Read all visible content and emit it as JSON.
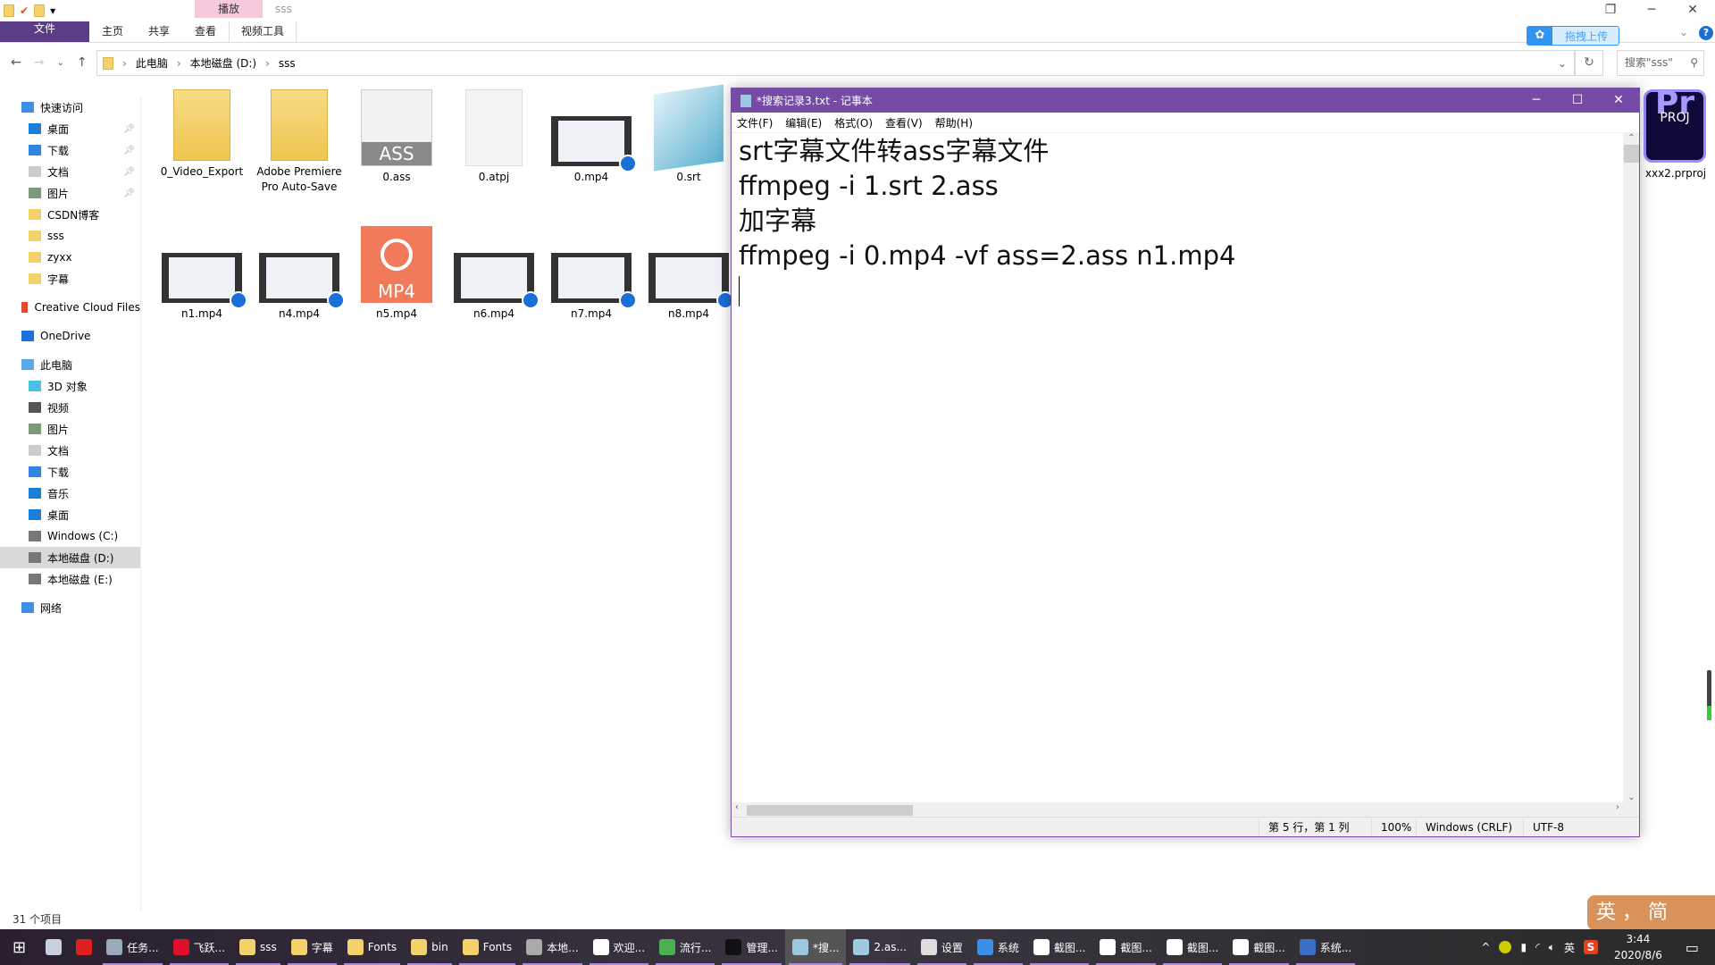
{
  "explorer": {
    "window_title": "sss",
    "context_tab_group": "播放",
    "ribbon_tabs": [
      "文件",
      "主页",
      "共享",
      "查看",
      "视频工具"
    ],
    "upload_label": "拖拽上传",
    "breadcrumb": [
      "此电脑",
      "本地磁盘 (D:)",
      "sss"
    ],
    "search_placeholder": "搜索\"sss\"",
    "sidebar": [
      {
        "label": "快速访问",
        "icon": "star-icon",
        "level": 0
      },
      {
        "label": "桌面",
        "icon": "desktop-icon",
        "level": 1,
        "pinned": true
      },
      {
        "label": "下载",
        "icon": "download-icon",
        "level": 1,
        "pinned": true
      },
      {
        "label": "文档",
        "icon": "document-icon",
        "level": 1,
        "pinned": true
      },
      {
        "label": "图片",
        "icon": "picture-icon",
        "level": 1,
        "pinned": true
      },
      {
        "label": "CSDN博客",
        "icon": "folder-icon",
        "level": 1
      },
      {
        "label": "sss",
        "icon": "folder-icon",
        "level": 1
      },
      {
        "label": "zyxx",
        "icon": "folder-icon",
        "level": 1
      },
      {
        "label": "字幕",
        "icon": "folder-icon",
        "level": 1
      },
      {
        "label": "Creative Cloud Files",
        "icon": "creative-cloud-icon",
        "level": 0
      },
      {
        "label": "OneDrive",
        "icon": "cloud-icon",
        "level": 0
      },
      {
        "label": "此电脑",
        "icon": "computer-icon",
        "level": 0
      },
      {
        "label": "3D 对象",
        "icon": "cube-icon",
        "level": 1
      },
      {
        "label": "视频",
        "icon": "video-icon",
        "level": 1
      },
      {
        "label": "图片",
        "icon": "picture-icon",
        "level": 1
      },
      {
        "label": "文档",
        "icon": "document-icon",
        "level": 1
      },
      {
        "label": "下载",
        "icon": "download-icon",
        "level": 1
      },
      {
        "label": "音乐",
        "icon": "music-icon",
        "level": 1
      },
      {
        "label": "桌面",
        "icon": "desktop-icon",
        "level": 1
      },
      {
        "label": "Windows (C:)",
        "icon": "drive-icon",
        "level": 1
      },
      {
        "label": "本地磁盘 (D:)",
        "icon": "drive-icon",
        "level": 1,
        "selected": true
      },
      {
        "label": "本地磁盘 (E:)",
        "icon": "drive-icon",
        "level": 1
      },
      {
        "label": "网络",
        "icon": "network-icon",
        "level": 0
      }
    ],
    "files_row1": [
      {
        "name": "0_Video_Export",
        "type": "folder"
      },
      {
        "name": "Adobe Premiere Pro Auto-Save",
        "type": "folder"
      },
      {
        "name": "0.ass",
        "type": "ass"
      },
      {
        "name": "0.atpj",
        "type": "blank"
      },
      {
        "name": "0.mp4",
        "type": "video"
      },
      {
        "name": "0.srt",
        "type": "notepad"
      }
    ],
    "files_row2": [
      {
        "name": "n1.mp4",
        "type": "video"
      },
      {
        "name": "n4.mp4",
        "type": "video"
      },
      {
        "name": "n5.mp4",
        "type": "mp4"
      },
      {
        "name": "n6.mp4",
        "type": "video"
      },
      {
        "name": "n7.mp4",
        "type": "video"
      },
      {
        "name": "n8.mp4",
        "type": "video"
      }
    ],
    "prproj": {
      "name": "xxx2.prproj",
      "icon_text": "Pr",
      "icon_sub": "PROJ"
    },
    "ass_icon_text": "ASS",
    "mp4_icon_text": "MP4",
    "status": "31 个项目"
  },
  "notepad": {
    "title": "*搜索记录3.txt - 记事本",
    "menu": [
      "文件(F)",
      "编辑(E)",
      "格式(O)",
      "查看(V)",
      "帮助(H)"
    ],
    "lines": [
      "srt字幕文件转ass字幕文件",
      "ffmpeg -i 1.srt 2.ass",
      "加字幕",
      "ffmpeg -i 0.mp4 -vf ass=2.ass n1.mp4",
      ""
    ],
    "status": {
      "position": "第 5 行，第 1 列",
      "zoom": "100%",
      "line_ending": "Windows (CRLF)",
      "encoding": "UTF-8"
    }
  },
  "taskbar": {
    "items": [
      {
        "label": "",
        "color": "#c8d0e0"
      },
      {
        "label": "",
        "color": "#e02020"
      },
      {
        "label": "任务...",
        "color": "#9ab"
      },
      {
        "label": "飞跃...",
        "color": "#e0102a"
      },
      {
        "label": "sss",
        "color": "#f4d26a"
      },
      {
        "label": "字幕",
        "color": "#f4d26a"
      },
      {
        "label": "Fonts",
        "color": "#f4d26a"
      },
      {
        "label": "bin",
        "color": "#f4d26a"
      },
      {
        "label": "Fonts",
        "color": "#f4d26a"
      },
      {
        "label": "本地...",
        "color": "#aaa"
      },
      {
        "label": "欢迎...",
        "color": "#fff"
      },
      {
        "label": "流行...",
        "color": "#4caf50"
      },
      {
        "label": "管理...",
        "color": "#111"
      },
      {
        "label": "*搜...",
        "color": "#9cc8e0",
        "active": true
      },
      {
        "label": "2.as...",
        "color": "#9cc8e0"
      },
      {
        "label": "设置",
        "color": "#ddd"
      },
      {
        "label": "系统",
        "color": "#3a8ee6"
      },
      {
        "label": "截图...",
        "color": "#fff"
      },
      {
        "label": "截图...",
        "color": "#fff"
      },
      {
        "label": "截图...",
        "color": "#fff"
      },
      {
        "label": "截图...",
        "color": "#fff"
      },
      {
        "label": "系统...",
        "color": "#3a6ec8"
      }
    ],
    "tray_lang": "英",
    "time": "3:44",
    "date": "2020/8/6"
  },
  "ime": {
    "text": "英 ， 简"
  },
  "colors": {
    "accent": "#764ba6",
    "file_tab": "#5b3c87",
    "context_tab": "#f8c8dc"
  }
}
